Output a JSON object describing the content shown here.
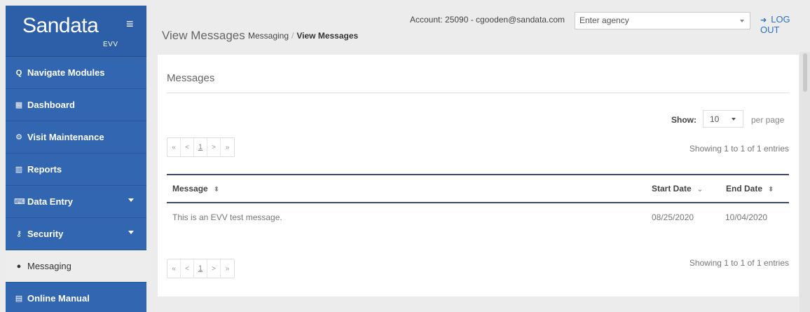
{
  "brand": {
    "logo": "Sandata",
    "sub": "EVV",
    "menu_icon": "hamburger-icon"
  },
  "sidebar": {
    "items": [
      {
        "label": "Navigate Modules",
        "icon": "search-icon",
        "glyph": "Q"
      },
      {
        "label": "Dashboard",
        "icon": "dashboard-icon",
        "glyph": "▦"
      },
      {
        "label": "Visit Maintenance",
        "icon": "gears-icon",
        "glyph": "⚙"
      },
      {
        "label": "Reports",
        "icon": "bar-chart-icon",
        "glyph": "▥"
      },
      {
        "label": "Data Entry",
        "icon": "keyboard-icon",
        "glyph": "⌨"
      },
      {
        "label": "Security",
        "icon": "key-icon",
        "glyph": "⚷"
      },
      {
        "label": "Messaging",
        "icon": "comments-icon",
        "glyph": "●"
      },
      {
        "label": "Online Manual",
        "icon": "manual-icon",
        "glyph": "▤"
      }
    ]
  },
  "header": {
    "title": "View Messages",
    "breadcrumb": {
      "parent": "Messaging",
      "separator": "/",
      "current": "View Messages"
    },
    "account": "Account: 25090 - cgooden@sandata.com",
    "agency_placeholder": "Enter agency",
    "logout": "LOG OUT"
  },
  "panel": {
    "title": "Messages",
    "show_label": "Show:",
    "page_size": "10",
    "per_page": "per page",
    "pager": {
      "first": "«",
      "prev": "<",
      "page": "1",
      "next": ">",
      "last": "»"
    },
    "entries_text": "Showing 1 to 1 of 1 entries"
  },
  "table": {
    "columns": [
      "Message",
      "Start Date",
      "End Date"
    ],
    "sort_symbols": {
      "message": "⬍",
      "start": "⌄",
      "end": "⬍"
    },
    "rows": [
      {
        "message": "This is an EVV test message.",
        "start": "08/25/2020",
        "end": "10/04/2020"
      }
    ]
  },
  "colors": {
    "sidebar": "#3366b0",
    "accent": "#2d6fc0",
    "table_rule": "#3c4a66"
  }
}
